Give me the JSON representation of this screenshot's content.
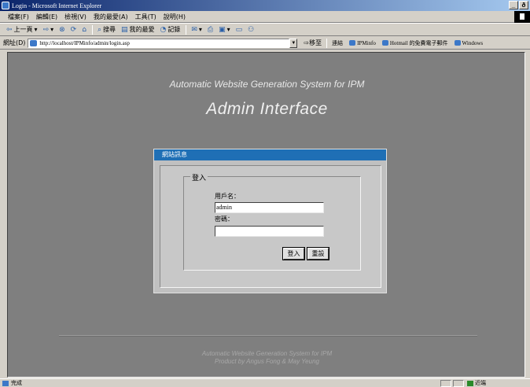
{
  "window": {
    "title": "Login - Microsoft Internet Explorer",
    "controls": {
      "minimize": "_",
      "restore": "ð"
    }
  },
  "menubar": {
    "items": [
      "檔案(F)",
      "編輯(E)",
      "檢視(V)",
      "我的最愛(A)",
      "工具(T)",
      "說明(H)"
    ]
  },
  "toolbar": {
    "back": "上一頁",
    "search": "搜尋",
    "favorites": "我的最愛",
    "history": "記錄"
  },
  "addressbar": {
    "label": "網址(D)",
    "url": "http://localhost/IPMinfo/admin/login.asp",
    "go": "移至",
    "links_label": "連結",
    "links": [
      "IPMinfo",
      "Hotmail 的免費電子郵件",
      "Windows"
    ]
  },
  "page": {
    "subtitle": "Automatic Website Generation System for IPM",
    "heading": "Admin Interface",
    "panel_title": "網站訊息",
    "group_label": "登入",
    "username_label": "用戶名：",
    "username_value": "admin",
    "password_label": "密碼：",
    "password_value": "",
    "login_button": "登入",
    "reset_button": "重設",
    "footer_line1": "Automatic Website Generation System for IPM",
    "footer_line2": "Product by Angus Fong & May Yeung"
  },
  "statusbar": {
    "status": "完成",
    "zone": "近端"
  }
}
